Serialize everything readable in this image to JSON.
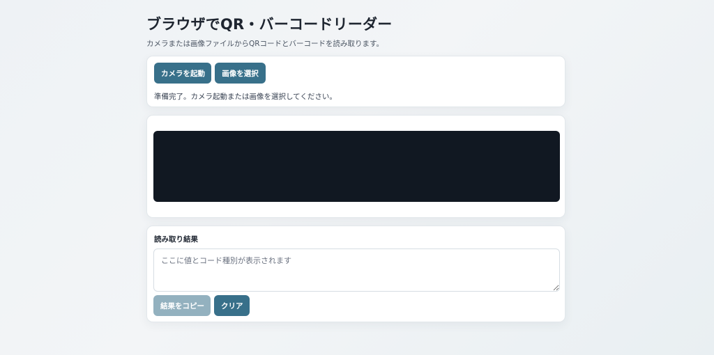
{
  "header": {
    "title": "ブラウザでQR・バーコードリーダー",
    "subtitle": "カメラまたは画像ファイルからQRコードとバーコードを読み取ります。"
  },
  "controls": {
    "camera_label": "カメラを起動",
    "image_label": "画像を選択",
    "status": "準備完了。カメラ起動または画像を選択してください。"
  },
  "result": {
    "label": "読み取り結果",
    "placeholder": "ここに値とコード種別が表示されます",
    "value": "",
    "copy_label": "結果をコピー",
    "clear_label": "クリア"
  },
  "colors": {
    "accent": "#38708a",
    "accent_disabled": "#93b1bf",
    "video_background": "#111822"
  }
}
